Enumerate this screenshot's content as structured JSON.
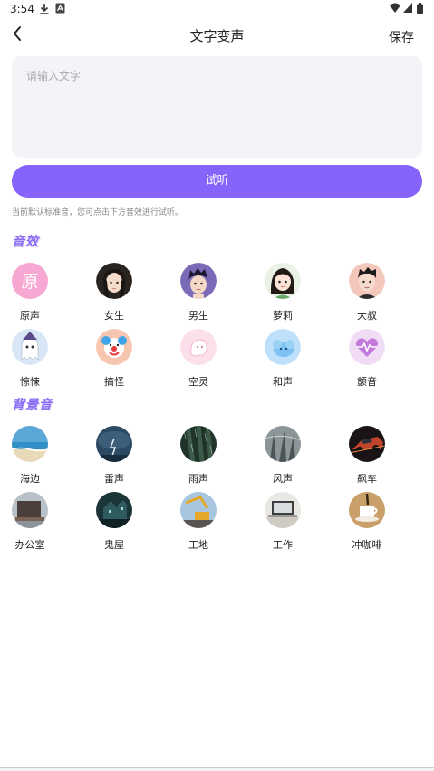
{
  "status_bar": {
    "time": "3:54"
  },
  "header": {
    "title": "文字变声",
    "save_label": "保存"
  },
  "input": {
    "placeholder": "请输入文字",
    "value": ""
  },
  "listen_button": {
    "label": "试听"
  },
  "hint": "当前默认标准音，您可点击下方音效进行试听。",
  "sections": {
    "effects": {
      "title": "音效",
      "items": [
        {
          "label": "原声",
          "icon": "original-icon"
        },
        {
          "label": "女生",
          "icon": "girl-avatar"
        },
        {
          "label": "男生",
          "icon": "boy-avatar"
        },
        {
          "label": "萝莉",
          "icon": "loli-avatar"
        },
        {
          "label": "大叔",
          "icon": "uncle-avatar"
        },
        {
          "label": "惊悚",
          "icon": "ghost-icon"
        },
        {
          "label": "搞怪",
          "icon": "clown-icon"
        },
        {
          "label": "空灵",
          "icon": "ethereal-icon"
        },
        {
          "label": "和声",
          "icon": "harmony-icon"
        },
        {
          "label": "颤音",
          "icon": "heartbeat-icon"
        }
      ]
    },
    "background": {
      "title": "背景音",
      "items": [
        {
          "label": "海边",
          "icon": "seaside-image"
        },
        {
          "label": "雷声",
          "icon": "thunder-image"
        },
        {
          "label": "雨声",
          "icon": "rain-image"
        },
        {
          "label": "风声",
          "icon": "wind-image"
        },
        {
          "label": "飙车",
          "icon": "racing-image"
        },
        {
          "label": "办公室",
          "icon": "office-image"
        },
        {
          "label": "鬼屋",
          "icon": "haunted-house-image"
        },
        {
          "label": "工地",
          "icon": "construction-image"
        },
        {
          "label": "工作",
          "icon": "work-image"
        },
        {
          "label": "冲咖啡",
          "icon": "coffee-image"
        }
      ]
    }
  },
  "colors": {
    "accent": "#8664fb",
    "section_title": "#8a6cf5",
    "input_bg": "#f3f4f8"
  }
}
